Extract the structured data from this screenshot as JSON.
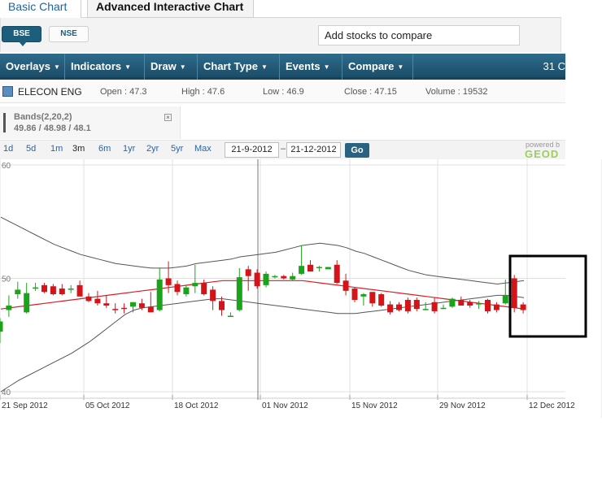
{
  "tabs": [
    {
      "label": "Basic Chart"
    },
    {
      "label": "Advanced Interactive Chart"
    }
  ],
  "exchange": {
    "buttons": [
      "BSE",
      "NSE"
    ],
    "selected": "BSE",
    "compare_placeholder": "Add stocks to compare"
  },
  "toolbar": {
    "items": [
      "Overlays",
      "Indicators",
      "Draw",
      "Chart Type",
      "Events",
      "Compare"
    ],
    "date_partial": "31 C"
  },
  "info": {
    "name": "ELECON ENG",
    "open": "Open : 47.3",
    "high": "High : 47.6",
    "low": "Low : 46.9",
    "close": "Close : 47.15",
    "volume": "Volume : 19532"
  },
  "bands": {
    "label": "Bands(2,20,2)",
    "values": "49.86 / 48.98 / 48.1",
    "close_glyph": "×"
  },
  "range": {
    "links": [
      "1d",
      "5d",
      "1m",
      "3m",
      "6m",
      "1yr",
      "2yr",
      "5yr",
      "Max"
    ],
    "selected": "3m",
    "from": "21-9-2012",
    "dash": "–",
    "to": "21-12-2012",
    "go_label": "Go",
    "powered": "powered b",
    "brand": "GEOD"
  },
  "colors": {
    "up": "#1ca31c",
    "down": "#d3151a",
    "middle_band": "#d81f26",
    "outer_band": "#555555",
    "grid": "#e0e0e0",
    "toolbar": "#245d7b",
    "highlight": "#000000"
  },
  "chart_data": {
    "type": "candlestick",
    "y_axis": {
      "ylim": [
        40,
        60
      ],
      "tick_labels": [
        "60",
        "50",
        "40"
      ]
    },
    "x_axis": {
      "tick_labels": [
        "21 Sep 2012",
        "05 Oct 2012",
        "18 Oct 2012",
        "01 Nov 2012",
        "15 Nov 2012",
        "29 Nov 2012",
        "12 Dec 2012"
      ]
    },
    "candles": [
      {
        "o": 45.3,
        "h": 46.5,
        "l": 44.3,
        "c": 46.2
      },
      {
        "o": 47.2,
        "h": 48.5,
        "l": 46.6,
        "c": 47.6
      },
      {
        "o": 48.6,
        "h": 49.7,
        "l": 48.2,
        "c": 49.0
      },
      {
        "o": 47.0,
        "h": 49.6,
        "l": 46.9,
        "c": 48.7
      },
      {
        "o": 49.1,
        "h": 49.6,
        "l": 48.9,
        "c": 49.2
      },
      {
        "o": 49.4,
        "h": 49.6,
        "l": 48.7,
        "c": 48.8
      },
      {
        "o": 49.3,
        "h": 49.5,
        "l": 48.5,
        "c": 48.6
      },
      {
        "o": 49.1,
        "h": 49.5,
        "l": 48.5,
        "c": 48.6
      },
      {
        "o": 49.0,
        "h": 49.4,
        "l": 48.7,
        "c": 49.1
      },
      {
        "o": 49.4,
        "h": 49.8,
        "l": 48.8,
        "c": 48.4
      },
      {
        "o": 48.4,
        "h": 48.7,
        "l": 47.9,
        "c": 48.0
      },
      {
        "o": 48.2,
        "h": 48.9,
        "l": 47.6,
        "c": 47.8
      },
      {
        "o": 47.8,
        "h": 48.5,
        "l": 47.4,
        "c": 47.6
      },
      {
        "o": 47.3,
        "h": 47.8,
        "l": 46.9,
        "c": 47.2
      },
      {
        "o": 47.4,
        "h": 47.8,
        "l": 46.9,
        "c": 47.3
      },
      {
        "o": 47.5,
        "h": 47.9,
        "l": 47.0,
        "c": 47.9
      },
      {
        "o": 47.8,
        "h": 48.2,
        "l": 47.2,
        "c": 47.4
      },
      {
        "o": 47.5,
        "h": 48.8,
        "l": 47.0,
        "c": 47.0
      },
      {
        "o": 47.2,
        "h": 50.9,
        "l": 47.1,
        "c": 49.9
      },
      {
        "o": 50.0,
        "h": 51.5,
        "l": 48.7,
        "c": 49.4
      },
      {
        "o": 49.5,
        "h": 49.8,
        "l": 48.5,
        "c": 48.8
      },
      {
        "o": 48.6,
        "h": 49.4,
        "l": 48.4,
        "c": 49.2
      },
      {
        "o": 49.3,
        "h": 51.2,
        "l": 48.7,
        "c": 49.6
      },
      {
        "o": 49.6,
        "h": 49.9,
        "l": 48.5,
        "c": 48.6
      },
      {
        "o": 49.0,
        "h": 49.3,
        "l": 47.2,
        "c": 48.0
      },
      {
        "o": 48.0,
        "h": 48.4,
        "l": 46.7,
        "c": 47.2
      },
      {
        "o": 46.7,
        "h": 47.0,
        "l": 46.7,
        "c": 46.7
      },
      {
        "o": 47.2,
        "h": 50.9,
        "l": 47.1,
        "c": 50.1
      },
      {
        "o": 50.8,
        "h": 51.1,
        "l": 48.9,
        "c": 50.2
      },
      {
        "o": 50.5,
        "h": 50.8,
        "l": 49.1,
        "c": 49.3
      },
      {
        "o": 49.4,
        "h": 50.6,
        "l": 49.2,
        "c": 50.4
      },
      {
        "o": 50.2,
        "h": 50.3,
        "l": 50.0,
        "c": 50.2
      },
      {
        "o": 50.2,
        "h": 50.3,
        "l": 49.9,
        "c": 50.0
      },
      {
        "o": 49.9,
        "h": 50.5,
        "l": 49.8,
        "c": 50.2
      },
      {
        "o": 50.4,
        "h": 52.9,
        "l": 50.3,
        "c": 51.1
      },
      {
        "o": 51.2,
        "h": 51.6,
        "l": 50.6,
        "c": 50.6
      },
      {
        "o": 50.9,
        "h": 51.1,
        "l": 50.6,
        "c": 51.0
      },
      {
        "o": 50.8,
        "h": 51.0,
        "l": 50.9,
        "c": 51.0
      },
      {
        "o": 51.2,
        "h": 51.6,
        "l": 49.5,
        "c": 49.6
      },
      {
        "o": 49.8,
        "h": 50.4,
        "l": 48.5,
        "c": 48.9
      },
      {
        "o": 49.1,
        "h": 49.2,
        "l": 47.9,
        "c": 48.1
      },
      {
        "o": 48.4,
        "h": 48.7,
        "l": 47.6,
        "c": 48.6
      },
      {
        "o": 48.8,
        "h": 48.8,
        "l": 47.5,
        "c": 47.8
      },
      {
        "o": 48.6,
        "h": 48.7,
        "l": 47.5,
        "c": 47.6
      },
      {
        "o": 47.7,
        "h": 48.0,
        "l": 46.8,
        "c": 47.0
      },
      {
        "o": 47.7,
        "h": 47.9,
        "l": 47.1,
        "c": 47.2
      },
      {
        "o": 48.1,
        "h": 48.3,
        "l": 46.9,
        "c": 47.1
      },
      {
        "o": 48.1,
        "h": 48.3,
        "l": 47.1,
        "c": 47.3
      },
      {
        "o": 47.3,
        "h": 47.9,
        "l": 47.2,
        "c": 47.3
      },
      {
        "o": 47.9,
        "h": 48.3,
        "l": 46.9,
        "c": 47.1
      },
      {
        "o": 47.3,
        "h": 47.7,
        "l": 47.3,
        "c": 47.4
      },
      {
        "o": 47.5,
        "h": 48.3,
        "l": 47.4,
        "c": 48.2
      },
      {
        "o": 48.1,
        "h": 48.4,
        "l": 47.7,
        "c": 47.6
      },
      {
        "o": 47.9,
        "h": 48.1,
        "l": 47.4,
        "c": 47.6
      },
      {
        "o": 47.8,
        "h": 48.0,
        "l": 47.3,
        "c": 47.8
      },
      {
        "o": 48.1,
        "h": 48.2,
        "l": 46.9,
        "c": 47.1
      },
      {
        "o": 47.7,
        "h": 47.9,
        "l": 47.0,
        "c": 47.2
      },
      {
        "o": 47.8,
        "h": 49.9,
        "l": 47.7,
        "c": 48.5
      },
      {
        "o": 50.0,
        "h": 50.3,
        "l": 47.0,
        "c": 47.4
      },
      {
        "o": 47.7,
        "h": 47.9,
        "l": 46.9,
        "c": 47.2
      }
    ],
    "upper_band": [
      55.4,
      55.0,
      54.6,
      54.2,
      53.8,
      53.4,
      53.0,
      52.7,
      52.4,
      52.1,
      51.9,
      51.7,
      51.5,
      51.3,
      51.2,
      51.1,
      51.0,
      50.9,
      50.9,
      50.9,
      51.0,
      51.1,
      51.3,
      51.4,
      51.5,
      51.6,
      51.7,
      51.9,
      52.0,
      52.1,
      52.2,
      52.3,
      52.5,
      52.7,
      52.9,
      53.0,
      53.1,
      53.0,
      52.9,
      52.7,
      52.4,
      52.2,
      51.9,
      51.6,
      51.3,
      51.0,
      50.7,
      50.5,
      50.3,
      50.2,
      50.1,
      50.0,
      49.9,
      49.8,
      49.7,
      49.6,
      49.5,
      49.6,
      49.7,
      49.8
    ],
    "middle_band": [
      47.3,
      47.4,
      47.5,
      47.6,
      47.7,
      47.8,
      47.9,
      48.0,
      48.1,
      48.2,
      48.3,
      48.4,
      48.5,
      48.6,
      48.7,
      48.8,
      48.9,
      49.0,
      49.1,
      49.2,
      49.3,
      49.4,
      49.5,
      49.6,
      49.7,
      49.8,
      49.8,
      49.8,
      49.8,
      49.8,
      49.8,
      49.8,
      49.8,
      49.8,
      49.8,
      49.7,
      49.6,
      49.5,
      49.4,
      49.3,
      49.2,
      49.1,
      49.0,
      48.9,
      48.8,
      48.7,
      48.6,
      48.5,
      48.4,
      48.3,
      48.2,
      48.1,
      48.0,
      47.9,
      47.8,
      47.7,
      47.6,
      47.5,
      47.4,
      47.3
    ],
    "lower_band": [
      40.0,
      40.5,
      41.0,
      41.4,
      41.8,
      42.2,
      42.6,
      43.0,
      43.4,
      43.9,
      44.4,
      45.0,
      45.6,
      46.2,
      46.8,
      47.2,
      47.4,
      47.5,
      47.6,
      47.7,
      47.8,
      47.9,
      48.0,
      48.1,
      48.2,
      48.2,
      48.1,
      48.0,
      47.9,
      47.8,
      47.7,
      47.6,
      47.5,
      47.4,
      47.3,
      47.2,
      47.1,
      47.0,
      46.9,
      46.9,
      46.9,
      47.0,
      47.1,
      47.2,
      47.3,
      47.4,
      47.5,
      47.6,
      47.7,
      47.8,
      47.9,
      48.0,
      48.1,
      48.2,
      48.3,
      48.4,
      48.5,
      48.5,
      48.4,
      48.3
    ]
  }
}
